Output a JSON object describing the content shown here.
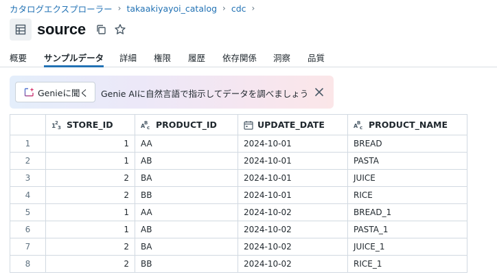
{
  "breadcrumb": {
    "items": [
      "カタログエクスプローラー",
      "takaakiyayoi_catalog",
      "cdc"
    ],
    "separator": "›"
  },
  "header": {
    "title": "source",
    "icons": [
      "table-icon",
      "copy-icon",
      "star-icon"
    ]
  },
  "tabs": [
    {
      "label": "概要",
      "active": false
    },
    {
      "label": "サンプルデータ",
      "active": true
    },
    {
      "label": "詳細",
      "active": false
    },
    {
      "label": "権限",
      "active": false
    },
    {
      "label": "履歴",
      "active": false
    },
    {
      "label": "依存関係",
      "active": false
    },
    {
      "label": "洞察",
      "active": false
    },
    {
      "label": "品質",
      "active": false
    }
  ],
  "genie_banner": {
    "button_label": "Genieに聞く",
    "message": "Genie AIに自然言語で指示してデータを調べましょう"
  },
  "table": {
    "columns": [
      {
        "name": "STORE_ID",
        "type_icon": "integer-type-icon"
      },
      {
        "name": "PRODUCT_ID",
        "type_icon": "string-type-icon"
      },
      {
        "name": "UPDATE_DATE",
        "type_icon": "date-type-icon"
      },
      {
        "name": "PRODUCT_NAME",
        "type_icon": "string-type-icon"
      }
    ],
    "rows": [
      {
        "index": "1",
        "cells": [
          "1",
          "AA",
          "2024-10-01",
          "BREAD"
        ]
      },
      {
        "index": "2",
        "cells": [
          "1",
          "AB",
          "2024-10-01",
          "PASTA"
        ]
      },
      {
        "index": "3",
        "cells": [
          "2",
          "BA",
          "2024-10-01",
          "JUICE"
        ]
      },
      {
        "index": "4",
        "cells": [
          "2",
          "BB",
          "2024-10-01",
          "RICE"
        ]
      },
      {
        "index": "5",
        "cells": [
          "1",
          "AA",
          "2024-10-02",
          "BREAD_1"
        ]
      },
      {
        "index": "6",
        "cells": [
          "1",
          "AB",
          "2024-10-02",
          "PASTA_1"
        ]
      },
      {
        "index": "7",
        "cells": [
          "2",
          "BA",
          "2024-10-02",
          "JUICE_1"
        ]
      },
      {
        "index": "8",
        "cells": [
          "2",
          "BB",
          "2024-10-02",
          "RICE_1"
        ]
      }
    ]
  },
  "colors": {
    "link": "#2272b4",
    "active_tab_underline": "#2272b4",
    "text": "#1f272d",
    "muted": "#5f7281",
    "border": "#d1d9e1",
    "banner_gradient": [
      "#e4eefb",
      "#fbe6e8"
    ]
  }
}
